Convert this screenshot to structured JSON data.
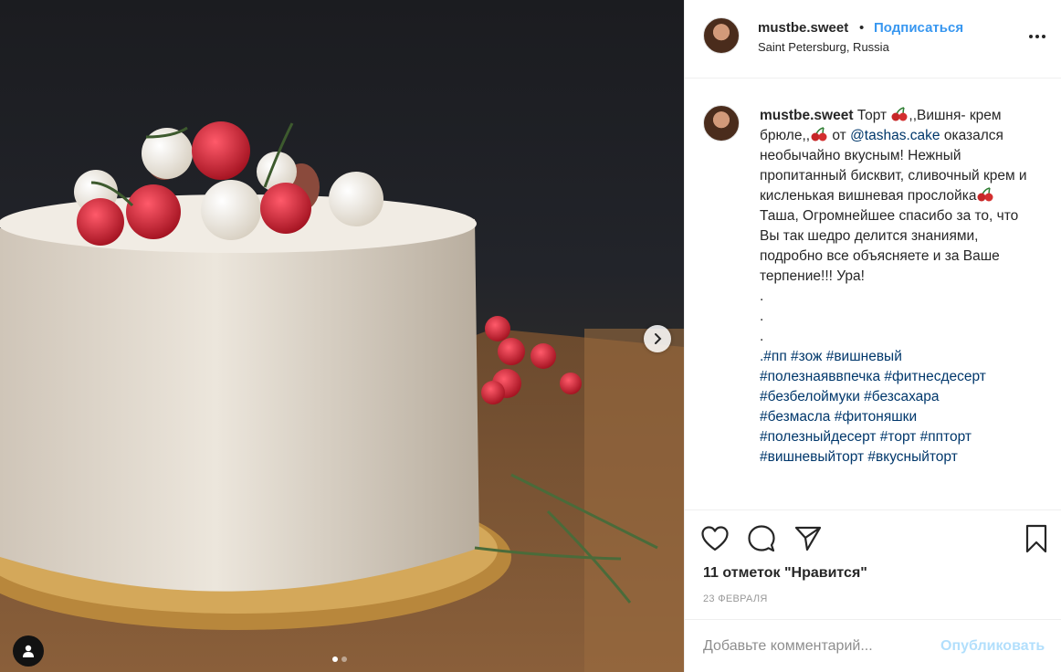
{
  "post": {
    "username": "mustbe.sweet",
    "separator": "•",
    "follow_label": "Подписаться",
    "location": "Saint Petersburg, Russia",
    "more_icon": "more-horizontal-icon"
  },
  "photo": {
    "next_icon": "chevron-right-icon",
    "user_tag_icon": "user-icon",
    "carousel_count": 2,
    "carousel_active": 0
  },
  "caption": {
    "username": "mustbe.sweet",
    "part1": " Торт ",
    "part2": ",,Вишня- крем брюле,,",
    "part3": " от ",
    "mention": "@tashas.cake",
    "part4": " оказался необычайно вкусным! Нежный пропитанный бисквит, сливочный крем и кисленькая вишневая прослойка",
    "part5": "\nТаша, Огромнейшее спасибо за то, что Вы так шедро делится знаниями, подробно все объясняете и за Ваше терпение!!! Ура!\n.\n.\n.\n",
    "tags_line1": ".#пп #зож #вишневый",
    "tags_line2": "#полезнаяввпечка #фитнесдесерт",
    "tags_line3": "#безбелоймуки #безсахара",
    "tags_line4": "#безмасла #фитоняшки",
    "tags_line5": "#полезныйдесерт #торт #пп­торт",
    "tags_line6": "#вишневыйторт #вкусныйторт"
  },
  "actions": {
    "like_icon": "heart-icon",
    "comment_icon": "comment-icon",
    "share_icon": "share-icon",
    "save_icon": "bookmark-icon",
    "likes_text": "11 отметок \"Нравится\"",
    "date": "23 ФЕВРАЛЯ"
  },
  "comment_form": {
    "placeholder": "Добавьте комментарий...",
    "publish_label": "Опубликовать"
  },
  "colors": {
    "link_blue": "#3897f0",
    "publish_disabled": "#b2dffc",
    "border": "#efefef",
    "text": "#262626",
    "muted": "#999999"
  }
}
